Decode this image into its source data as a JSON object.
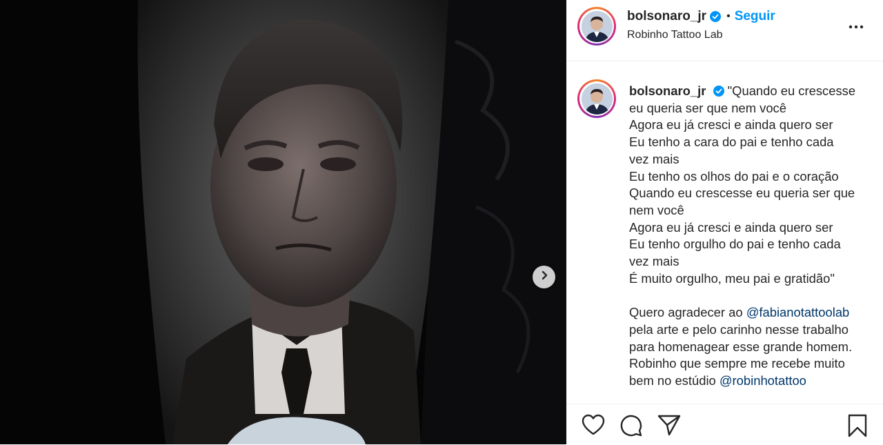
{
  "post": {
    "username": "bolsonaro_jr",
    "verified": true,
    "follow_label": "Seguir",
    "separator": "•",
    "location": "Robinho Tattoo Lab"
  },
  "caption": {
    "username": "bolsonaro_jr",
    "lines": [
      "\"Quando eu crescesse",
      "eu queria ser que nem você",
      "Agora eu já cresci e ainda quero ser",
      "Eu tenho a cara do pai e tenho cada",
      "vez mais",
      "Eu tenho os olhos do pai e o coração",
      "Quando eu crescesse eu queria ser que",
      "nem você",
      "Agora eu já cresci e ainda quero ser",
      "Eu tenho orgulho do pai e tenho cada",
      "vez mais",
      "É muito orgulho, meu pai e gratidão\""
    ],
    "thanks_prefix": "Quero agradecer ao ",
    "mention_1": "@fabianotattoolab",
    "thanks_lines": [
      "pela arte e pelo carinho nesse trabalho",
      "para homenagear esse grande homem.",
      "Robinho que sempre me recebe muito"
    ],
    "last_prefix": "bem no estúdio ",
    "mention_2": "@robinhotattoo"
  },
  "icons": {
    "verified": "verified-badge-icon",
    "more": "more-horizontal-icon",
    "next": "chevron-right-icon",
    "like": "heart-icon",
    "comment": "comment-icon",
    "share": "paper-plane-icon",
    "save": "bookmark-icon"
  },
  "colors": {
    "accent": "#0095f6",
    "text": "#262626",
    "mention": "#00376b"
  }
}
